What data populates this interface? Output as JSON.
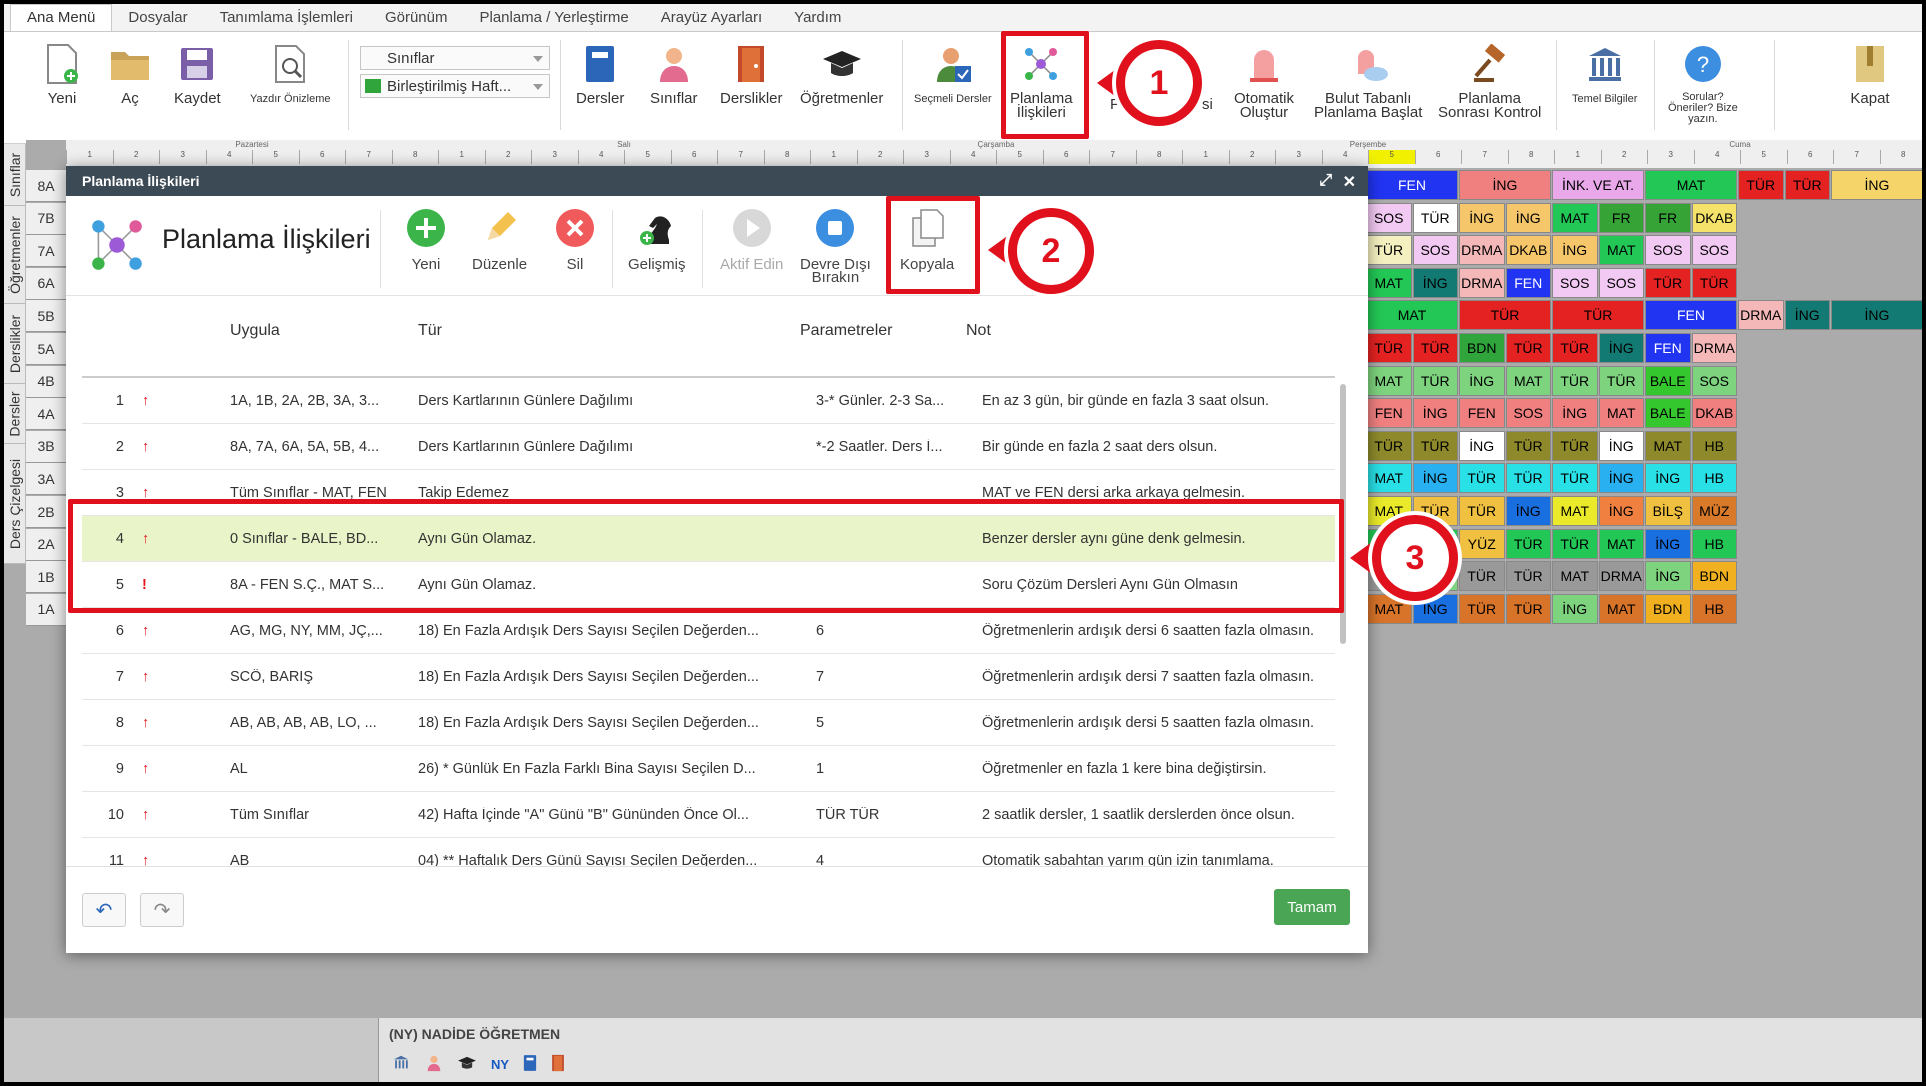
{
  "menu": [
    "Ana Menü",
    "Dosyalar",
    "Tanımlama İşlemleri",
    "Görünüm",
    "Planlama / Yerleştirme",
    "Arayüz Ayarları",
    "Yardım"
  ],
  "ribbon": {
    "new": "Yeni",
    "open": "Aç",
    "save": "Kaydet",
    "print_preview": "Yazdır Önizleme",
    "select_classes": "Sınıflar",
    "select_view": "Birleştirilmiş Haft...",
    "lessons": "Dersler",
    "classes": "Sınıflar",
    "rooms": "Derslikler",
    "teachers": "Öğretmenler",
    "elective": "Seçmeli Dersler",
    "planning_relations_1": "Planlama",
    "planning_relations_2": "İlişkileri",
    "hidden_p": "P",
    "hidden_si": "si",
    "auto_1": "Otomatik",
    "auto_2": "Oluştur",
    "cloud_1": "Bulut Tabanlı",
    "cloud_2": "Planlama Başlat",
    "post_1": "Planlama",
    "post_2": "Sonrası Kontrol",
    "basic": "Temel Bilgiler",
    "help_1": "Sorular?",
    "help_2": "Öneriler? Bize",
    "help_3": "yazın.",
    "close": "Kapat"
  },
  "annotations": {
    "one": "1",
    "two": "2",
    "three": "3"
  },
  "left_tabs": [
    "Sınıflar",
    "Öğretmenler",
    "Derslikler",
    "Dersler",
    "Ders Çizelgesi"
  ],
  "days": [
    "Pazartesi",
    "Salı",
    "Çarşamba",
    "Perşembe",
    "Cuma"
  ],
  "period_labels": [
    "1",
    "2",
    "3",
    "4",
    "5",
    "6",
    "7",
    "8"
  ],
  "row_labels": [
    "8A",
    "7B",
    "7A",
    "6A",
    "5B",
    "5A",
    "4B",
    "4A",
    "3B",
    "3A",
    "2B",
    "2A",
    "1B",
    "1A"
  ],
  "colors": {
    "accent_red": "#e0101c",
    "ok_green": "#4aa555",
    "dialog_title": "#3c4a55",
    "selected_row": "#e9f5c9"
  },
  "schedule": [
    [
      {
        "t": "FEN",
        "c": "#2134f2",
        "f": "#fff"
      },
      {
        "t": "İNG",
        "c": "#f08080",
        "f": "#000"
      },
      {
        "t": "İNK. VE AT.",
        "c": "#e8a8ea",
        "f": "#000"
      },
      {
        "t": "MAT",
        "c": "#22c755",
        "f": "#000"
      },
      {
        "t": "TÜR",
        "c": "#e52222",
        "f": "#000"
      },
      {
        "t": "TÜR",
        "c": "#e52222",
        "f": "#000"
      },
      {
        "t": "İNG",
        "c": "#f5d56a",
        "f": "#000"
      }
    ],
    [
      {
        "t": "SOS",
        "c": "#f2c9f2",
        "f": "#000"
      },
      {
        "t": "TÜR",
        "c": "#fff",
        "f": "#000"
      },
      {
        "t": "İNG",
        "c": "#f5c66a",
        "f": "#000"
      },
      {
        "t": "İNG",
        "c": "#f5c66a",
        "f": "#000"
      },
      {
        "t": "MAT",
        "c": "#22c755",
        "f": "#000"
      },
      {
        "t": "FR",
        "c": "#36a336",
        "f": "#000"
      },
      {
        "t": "FR",
        "c": "#36a336",
        "f": "#000"
      },
      {
        "t": "DKAB",
        "c": "#f5e26a",
        "f": "#000"
      }
    ],
    [
      {
        "t": "TÜR",
        "c": "#f5f0c0",
        "f": "#000"
      },
      {
        "t": "SOS",
        "c": "#f2c9f2",
        "f": "#000"
      },
      {
        "t": "DRMA",
        "c": "#f4b8b8",
        "f": "#000"
      },
      {
        "t": "DKAB",
        "c": "#f5c66a",
        "f": "#000"
      },
      {
        "t": "İNG",
        "c": "#f5c66a",
        "f": "#000"
      },
      {
        "t": "MAT",
        "c": "#22c755",
        "f": "#000"
      },
      {
        "t": "SOS",
        "c": "#f2c9f2",
        "f": "#000"
      },
      {
        "t": "SOS",
        "c": "#f2c9f2",
        "f": "#000"
      }
    ],
    [
      {
        "t": "MAT",
        "c": "#22c755",
        "f": "#000"
      },
      {
        "t": "İNG",
        "c": "#137a73",
        "f": "#000"
      },
      {
        "t": "DRMA",
        "c": "#f4b8b8",
        "f": "#000"
      },
      {
        "t": "FEN",
        "c": "#2134f2",
        "f": "#fff"
      },
      {
        "t": "SOS",
        "c": "#f2c9f2",
        "f": "#000"
      },
      {
        "t": "SOS",
        "c": "#f2c9f2",
        "f": "#000"
      },
      {
        "t": "TÜR",
        "c": "#e52222",
        "f": "#000"
      },
      {
        "t": "TÜR",
        "c": "#e52222",
        "f": "#000"
      }
    ],
    [
      {
        "t": "MAT",
        "c": "#22c755",
        "f": "#000"
      },
      {
        "t": "TÜR",
        "c": "#e52222",
        "f": "#000"
      },
      {
        "t": "TÜR",
        "c": "#e52222",
        "f": "#000"
      },
      {
        "t": "FEN",
        "c": "#2134f2",
        "f": "#fff"
      },
      {
        "t": "DRMA",
        "c": "#f4b8b8",
        "f": "#000"
      },
      {
        "t": "İNG",
        "c": "#137a73",
        "f": "#000"
      },
      {
        "t": "İNG",
        "c": "#137a73",
        "f": "#000"
      }
    ],
    [
      {
        "t": "TÜR",
        "c": "#e52222",
        "f": "#000"
      },
      {
        "t": "TÜR",
        "c": "#e52222",
        "f": "#000"
      },
      {
        "t": "BDN",
        "c": "#2fa53b",
        "f": "#000"
      },
      {
        "t": "TÜR",
        "c": "#e52222",
        "f": "#000"
      },
      {
        "t": "TÜR",
        "c": "#e52222",
        "f": "#000"
      },
      {
        "t": "İNG",
        "c": "#137a73",
        "f": "#000"
      },
      {
        "t": "FEN",
        "c": "#2134f2",
        "f": "#fff"
      },
      {
        "t": "DRMA",
        "c": "#f4b8b8",
        "f": "#000"
      }
    ],
    [
      {
        "t": "MAT",
        "c": "#7ed37e",
        "f": "#000"
      },
      {
        "t": "TÜR",
        "c": "#7ed37e",
        "f": "#000"
      },
      {
        "t": "İNG",
        "c": "#7ed37e",
        "f": "#000"
      },
      {
        "t": "MAT",
        "c": "#7ed37e",
        "f": "#000"
      },
      {
        "t": "TÜR",
        "c": "#7ed37e",
        "f": "#000"
      },
      {
        "t": "TÜR",
        "c": "#7ed37e",
        "f": "#000"
      },
      {
        "t": "BALE",
        "c": "#35c72e",
        "f": "#000"
      },
      {
        "t": "SOS",
        "c": "#7ed37e",
        "f": "#000"
      }
    ],
    [
      {
        "t": "FEN",
        "c": "#f08080",
        "f": "#000"
      },
      {
        "t": "İNG",
        "c": "#f08080",
        "f": "#000"
      },
      {
        "t": "FEN",
        "c": "#f08080",
        "f": "#000"
      },
      {
        "t": "SOS",
        "c": "#f08080",
        "f": "#000"
      },
      {
        "t": "İNG",
        "c": "#f08080",
        "f": "#000"
      },
      {
        "t": "MAT",
        "c": "#f08080",
        "f": "#000"
      },
      {
        "t": "BALE",
        "c": "#35c72e",
        "f": "#000"
      },
      {
        "t": "DKAB",
        "c": "#f08080",
        "f": "#000"
      }
    ],
    [
      {
        "t": "TÜR",
        "c": "#8e8a2c",
        "f": "#000"
      },
      {
        "t": "TÜR",
        "c": "#8e8a2c",
        "f": "#000"
      },
      {
        "t": "İNG",
        "c": "#fff",
        "f": "#000"
      },
      {
        "t": "TÜR",
        "c": "#8e8a2c",
        "f": "#000"
      },
      {
        "t": "TÜR",
        "c": "#8e8a2c",
        "f": "#000"
      },
      {
        "t": "İNG",
        "c": "#fff",
        "f": "#000"
      },
      {
        "t": "MAT",
        "c": "#8e8a2c",
        "f": "#000"
      },
      {
        "t": "HB",
        "c": "#8e8a2c",
        "f": "#000"
      }
    ],
    [
      {
        "t": "MAT",
        "c": "#28e0e6",
        "f": "#000"
      },
      {
        "t": "İNG",
        "c": "#28b0f0",
        "f": "#000"
      },
      {
        "t": "TÜR",
        "c": "#28e0e6",
        "f": "#000"
      },
      {
        "t": "TÜR",
        "c": "#28e0e6",
        "f": "#000"
      },
      {
        "t": "TÜR",
        "c": "#28e0e6",
        "f": "#000"
      },
      {
        "t": "İNG",
        "c": "#28b0f0",
        "f": "#000"
      },
      {
        "t": "İNG",
        "c": "#28e0e6",
        "f": "#000"
      },
      {
        "t": "HB",
        "c": "#28e0e6",
        "f": "#000"
      }
    ],
    [
      {
        "t": "MAT",
        "c": "#eaea2a",
        "f": "#000"
      },
      {
        "t": "TÜR",
        "c": "#f0c040",
        "f": "#000"
      },
      {
        "t": "TÜR",
        "c": "#f0c040",
        "f": "#000"
      },
      {
        "t": "İNG",
        "c": "#1a6fe0",
        "f": "#000"
      },
      {
        "t": "MAT",
        "c": "#eaea2a",
        "f": "#000"
      },
      {
        "t": "İNG",
        "c": "#f08040",
        "f": "#000"
      },
      {
        "t": "BİLŞ",
        "c": "#f0c040",
        "f": "#000"
      },
      {
        "t": "MÜZ",
        "c": "#d87a2a",
        "f": "#000"
      }
    ],
    [
      {
        "t": "MAT",
        "c": "#22c755",
        "f": "#000"
      },
      {
        "t": "TÜR",
        "c": "#22c755",
        "f": "#000"
      },
      {
        "t": "YÜZ",
        "c": "#f0c040",
        "f": "#000"
      },
      {
        "t": "TÜR",
        "c": "#22c755",
        "f": "#000"
      },
      {
        "t": "TÜR",
        "c": "#22c755",
        "f": "#000"
      },
      {
        "t": "MAT",
        "c": "#22c755",
        "f": "#000"
      },
      {
        "t": "İNG",
        "c": "#1a6fe0",
        "f": "#000"
      },
      {
        "t": "HB",
        "c": "#22c755",
        "f": "#000"
      }
    ],
    [
      {
        "t": "MAT",
        "c": "#999",
        "f": "#000"
      },
      {
        "t": "İNG",
        "c": "#7ed37e",
        "f": "#000"
      },
      {
        "t": "TÜR",
        "c": "#999",
        "f": "#000"
      },
      {
        "t": "TÜR",
        "c": "#999",
        "f": "#000"
      },
      {
        "t": "MAT",
        "c": "#999",
        "f": "#000"
      },
      {
        "t": "DRMA",
        "c": "#999",
        "f": "#000"
      },
      {
        "t": "İNG",
        "c": "#7ed37e",
        "f": "#000"
      },
      {
        "t": "BDN",
        "c": "#f0b020",
        "f": "#000"
      }
    ],
    [
      {
        "t": "MAT",
        "c": "#d8742a",
        "f": "#000"
      },
      {
        "t": "İNG",
        "c": "#1a6fe0",
        "f": "#000"
      },
      {
        "t": "TÜR",
        "c": "#d8742a",
        "f": "#000"
      },
      {
        "t": "TÜR",
        "c": "#d8742a",
        "f": "#000"
      },
      {
        "t": "İNG",
        "c": "#7ed37e",
        "f": "#000"
      },
      {
        "t": "MAT",
        "c": "#d8742a",
        "f": "#000"
      },
      {
        "t": "BDN",
        "c": "#f0b020",
        "f": "#000"
      },
      {
        "t": "HB",
        "c": "#d8742a",
        "f": "#000"
      }
    ]
  ],
  "dialog": {
    "title": "Planlama İlişkileri",
    "heading": "Planlama İlişkileri",
    "toolbar": {
      "new": "Yeni",
      "edit": "Düzenle",
      "delete": "Sil",
      "advanced": "Gelişmiş",
      "activate": "Aktif Edin",
      "deactivate_1": "Devre Dışı",
      "deactivate_2": "Bırakın",
      "copy": "Kopyala"
    },
    "columns": {
      "apply": "Uygula",
      "type": "Tür",
      "params": "Parametreler",
      "note": "Not"
    },
    "rows": [
      {
        "no": "1",
        "icon": "↑",
        "apply": "1A, 1B, 2A, 2B, 3A, 3...",
        "type": "Ders Kartlarının Günlere Dağılımı",
        "params": "3-* Günler. 2-3 Sa...",
        "note": "En az 3 gün, bir günde en fazla 3 saat olsun."
      },
      {
        "no": "2",
        "icon": "↑",
        "apply": "8A, 7A, 6A, 5A, 5B, 4...",
        "type": "Ders Kartlarının Günlere Dağılımı",
        "params": "*-2 Saatler. Ders İ...",
        "note": "Bir günde en fazla 2 saat ders olsun."
      },
      {
        "no": "3",
        "icon": "↑",
        "apply": "Tüm Sınıflar - MAT, FEN",
        "type": "Takip Edemez",
        "params": "",
        "note": "MAT ve FEN dersi arka arkaya gelmesin."
      },
      {
        "no": "4",
        "icon": "↑",
        "apply": "0 Sınıflar - BALE, BD...",
        "type": "Aynı Gün Olamaz.",
        "params": "",
        "note": "Benzer dersler aynı güne denk gelmesin."
      },
      {
        "no": "5",
        "icon": "!",
        "apply": "8A - FEN S.Ç., MAT S...",
        "type": "Aynı Gün Olamaz.",
        "params": "",
        "note": "Soru Çözüm Dersleri Aynı Gün Olmasın"
      },
      {
        "no": "6",
        "icon": "↑",
        "apply": "AG, MG, NY, MM, JÇ,...",
        "type": "18) En Fazla Ardışık Ders Sayısı Seçilen Değerden...",
        "params": "6",
        "note": "Öğretmenlerin ardışık dersi 6 saatten fazla olmasın."
      },
      {
        "no": "7",
        "icon": "↑",
        "apply": "SCÖ, BARIŞ",
        "type": "18) En Fazla Ardışık Ders Sayısı Seçilen Değerden...",
        "params": "7",
        "note": "Öğretmenlerin ardışık dersi 7 saatten fazla olmasın."
      },
      {
        "no": "8",
        "icon": "↑",
        "apply": "AB, AB, AB, AB, LO, ...",
        "type": "18) En Fazla Ardışık Ders Sayısı Seçilen Değerden...",
        "params": "5",
        "note": "Öğretmenlerin ardışık dersi 5 saatten fazla olmasın."
      },
      {
        "no": "9",
        "icon": "↑",
        "apply": "AL",
        "type": "26) * Günlük En Fazla Farklı Bina Sayısı Seçilen D...",
        "params": "1",
        "note": "Öğretmenler en fazla 1 kere bina değiştirsin."
      },
      {
        "no": "10",
        "icon": "↑",
        "apply": "Tüm Sınıflar",
        "type": "42) Hafta İçinde \"A\" Günü \"B\" Gününden Önce Ol...",
        "params": "TÜR TÜR",
        "note": "2 saatlik dersler, 1 saatlik derslerden önce olsun."
      },
      {
        "no": "11",
        "icon": "↑",
        "apply": "AB",
        "type": "04) ** Haftalık Ders Günü Sayısı Seçilen Değerden...",
        "params": "4",
        "note": "Otomatik sabahtan yarım gün izin tanımlama."
      }
    ],
    "ok": "Tamam"
  },
  "bottom": {
    "teacher": "(NY) NADİDE ÖĞRETMEN",
    "ny": "NY"
  }
}
